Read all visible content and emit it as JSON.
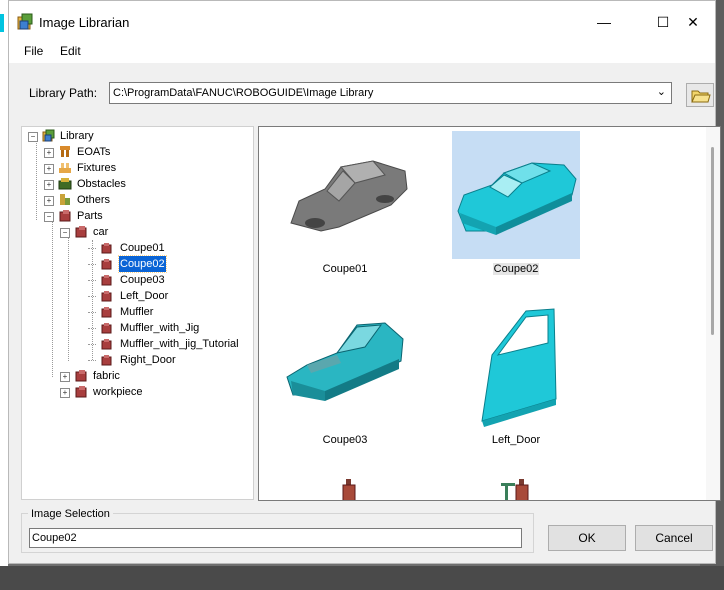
{
  "window": {
    "title": "Image Librarian"
  },
  "title_buttons": {
    "minimize": "—",
    "maximize": "☐",
    "close": "✕"
  },
  "menu": {
    "file": "File",
    "edit": "Edit"
  },
  "library_path": {
    "label": "Library Path:",
    "value": "C:\\ProgramData\\FANUC\\ROBOGUIDE\\Image Library",
    "dropdown_arrow": "⌄"
  },
  "tree": {
    "root": "Library",
    "categories": [
      "EOATs",
      "Fixtures",
      "Obstacles",
      "Others",
      "Parts"
    ],
    "parts_children": [
      "car",
      "fabric",
      "workpiece"
    ],
    "car_items": [
      "Coupe01",
      "Coupe02",
      "Coupe03",
      "Left_Door",
      "Muffler",
      "Muffler_with_Jig",
      "Muffler_with_jig_Tutorial",
      "Right_Door"
    ],
    "selected": "Coupe02"
  },
  "grid": {
    "items": [
      "Coupe01",
      "Coupe02",
      "Coupe03",
      "Left_Door"
    ]
  },
  "image_selection": {
    "label": "Image Selection",
    "value": "Coupe02"
  },
  "buttons": {
    "ok": "OK",
    "cancel": "Cancel"
  },
  "colors": {
    "accent": "#00c4e0",
    "selection": "#0a64d6",
    "thumb_selection": "#c6ddf4",
    "cyan_model": "#1fc8d8"
  }
}
